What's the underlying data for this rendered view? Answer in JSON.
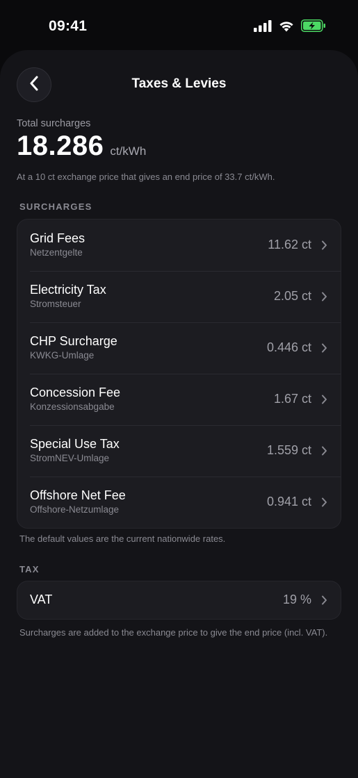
{
  "status_bar": {
    "time": "09:41"
  },
  "nav": {
    "title": "Taxes & Levies"
  },
  "summary": {
    "label": "Total surcharges",
    "value": "18.286",
    "unit": "ct/kWh",
    "description": "At a 10 ct exchange price that gives an end price of 33.7 ct/kWh."
  },
  "surcharges": {
    "header": "SURCHARGES",
    "items": [
      {
        "title": "Grid Fees",
        "subtitle": "Netzentgelte",
        "value": "11.62 ct"
      },
      {
        "title": "Electricity Tax",
        "subtitle": "Stromsteuer",
        "value": "2.05 ct"
      },
      {
        "title": "CHP Surcharge",
        "subtitle": "KWKG-Umlage",
        "value": "0.446 ct"
      },
      {
        "title": "Concession Fee",
        "subtitle": "Konzessionsabgabe",
        "value": "1.67 ct"
      },
      {
        "title": "Special Use Tax",
        "subtitle": "StromNEV-Umlage",
        "value": "1.559 ct"
      },
      {
        "title": "Offshore Net Fee",
        "subtitle": "Offshore-Netzumlage",
        "value": "0.941 ct"
      }
    ],
    "footnote": "The default values are the current nationwide rates."
  },
  "tax": {
    "header": "TAX",
    "items": [
      {
        "title": "VAT",
        "value": "19 %"
      }
    ],
    "footnote": "Surcharges are added to the exchange price to give the end price (incl. VAT)."
  },
  "colors": {
    "background": "#0a0a0c",
    "sheet": "#141418",
    "card": "#1c1c21",
    "battery": "#4cd964"
  }
}
